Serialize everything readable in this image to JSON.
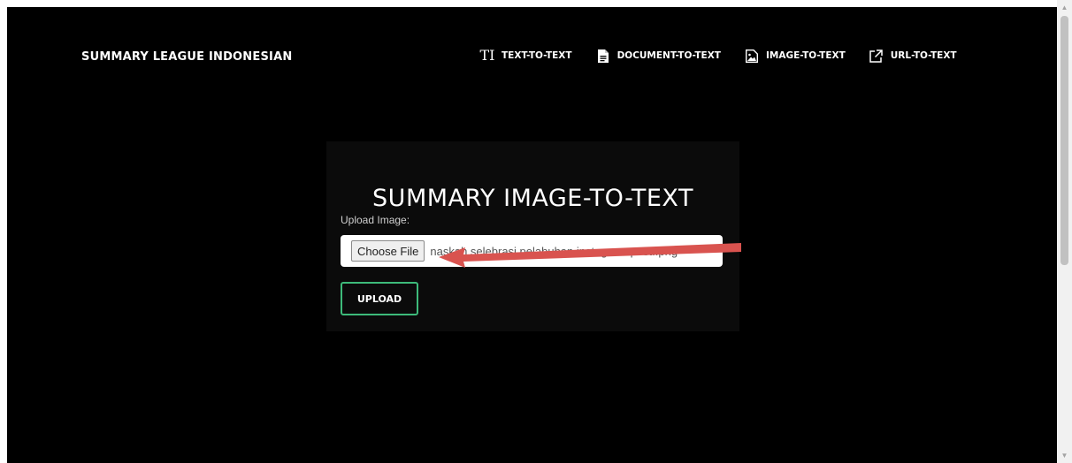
{
  "navbar": {
    "brand": "SUMMARY LEAGUE INDONESIAN",
    "items": [
      {
        "label": "TEXT-TO-TEXT",
        "icon": "text-size-icon",
        "icon_glyph": "TI"
      },
      {
        "label": "DOCUMENT-TO-TEXT",
        "icon": "document-icon"
      },
      {
        "label": "IMAGE-TO-TEXT",
        "icon": "image-icon"
      },
      {
        "label": "URL-TO-TEXT",
        "icon": "external-link-icon"
      }
    ]
  },
  "main": {
    "title": "SUMMARY IMAGE-TO-TEXT",
    "upload_label": "Upload Image:",
    "file_input": {
      "button_label": "Choose File",
      "file_name": "naskah selebrasi pelabuhan instagram post..png"
    },
    "upload_button": "UPLOAD"
  },
  "colors": {
    "background": "#000000",
    "card": "#0b0b0b",
    "accent": "#3dba7a",
    "annotation_arrow": "#d9534f"
  }
}
